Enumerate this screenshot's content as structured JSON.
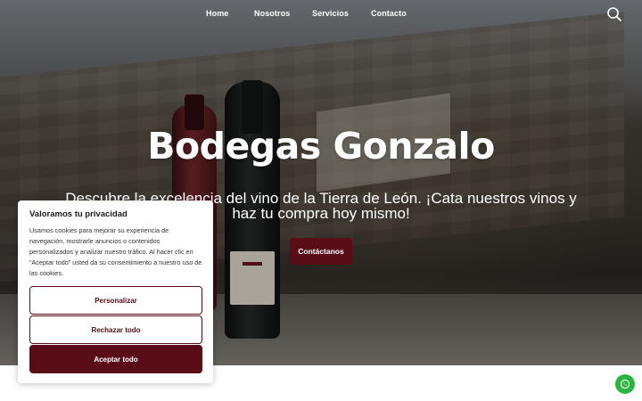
{
  "nav": {
    "items": [
      {
        "label": "Home"
      },
      {
        "label": "Nosotros"
      },
      {
        "label": "Servicios"
      },
      {
        "label": "Contacto"
      }
    ],
    "search_icon": "search-icon"
  },
  "hero": {
    "title": "Bodegas Gonzalo",
    "subtitle_line1": "Descubre la excelencia del vino de la Tierra de León. ¡Cata nuestros vinos y",
    "subtitle_line2": "haz tu compra hoy mismo!",
    "cta_label": "Contáctanos"
  },
  "cookie_banner": {
    "title": "Valoramos tu privacidad",
    "body": "Usamos cookies para mejorar su experiencia de navegación, mostrarle anuncios o contenidos personalizados y analizar nuestro tráfico. Al hacer clic en “Aceptar todo” usted da su consentimiento a nuestro uso de las cookies.",
    "buttons": {
      "customize": "Personalizar",
      "reject": "Rechazar todo",
      "accept": "Aceptar todo"
    }
  },
  "floating": {
    "whatsapp_icon": "whatsapp-icon"
  },
  "colors": {
    "brand": "#5a0d17",
    "whatsapp": "#2ab540"
  }
}
